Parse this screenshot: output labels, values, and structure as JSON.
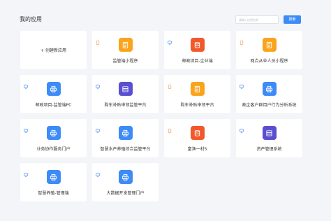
{
  "page": {
    "title": "我的应用",
    "search_placeholder": "请输入应用名称",
    "search_button": "搜索",
    "add_label": "+ 创建新应用"
  },
  "colors": {
    "orange": "#f9a41c",
    "red": "#f1592a",
    "blue": "#3d8bf7",
    "purple": "#5a4fd0",
    "type_mobile": "#f3a46b",
    "type_pc": "#4a8cf0"
  },
  "apps": [
    {
      "name": "监管端小程序",
      "type": "mobile",
      "icon": "document-icon",
      "color": "orange"
    },
    {
      "name": "邮政项目-企业端",
      "type": "pc",
      "icon": "database-icon",
      "color": "red"
    },
    {
      "name": "网点从业人员小程序",
      "type": "mobile",
      "icon": "document-icon",
      "color": "orange"
    },
    {
      "name": "邮政项目-监管端PC",
      "type": "pc",
      "icon": "printer-icon",
      "color": "blue"
    },
    {
      "name": "购车补贴申领监管平台",
      "type": "pc",
      "icon": "grid-icon",
      "color": "purple"
    },
    {
      "name": "购车补贴申领平台",
      "type": "mobile",
      "icon": "document-icon",
      "color": "orange"
    },
    {
      "name": "政企客户群用户行为分析系统",
      "type": "pc",
      "icon": "printer-icon",
      "color": "blue"
    },
    {
      "name": "业务协作服务门户",
      "type": "pc",
      "icon": "printer-icon",
      "color": "blue"
    },
    {
      "name": "智慧水产养殖综合监管平台",
      "type": "pc",
      "icon": "printer-icon",
      "color": "blue"
    },
    {
      "name": "富渔一村5",
      "type": "mobile",
      "icon": "database-icon",
      "color": "red"
    },
    {
      "name": "资产管理系统",
      "type": "pc",
      "icon": "grid-icon",
      "color": "purple"
    },
    {
      "name": "智慧养殖-管理端",
      "type": "pc",
      "icon": "printer-icon",
      "color": "blue"
    },
    {
      "name": "大数据开发管理门户",
      "type": "pc",
      "icon": "printer-icon",
      "color": "blue"
    }
  ]
}
